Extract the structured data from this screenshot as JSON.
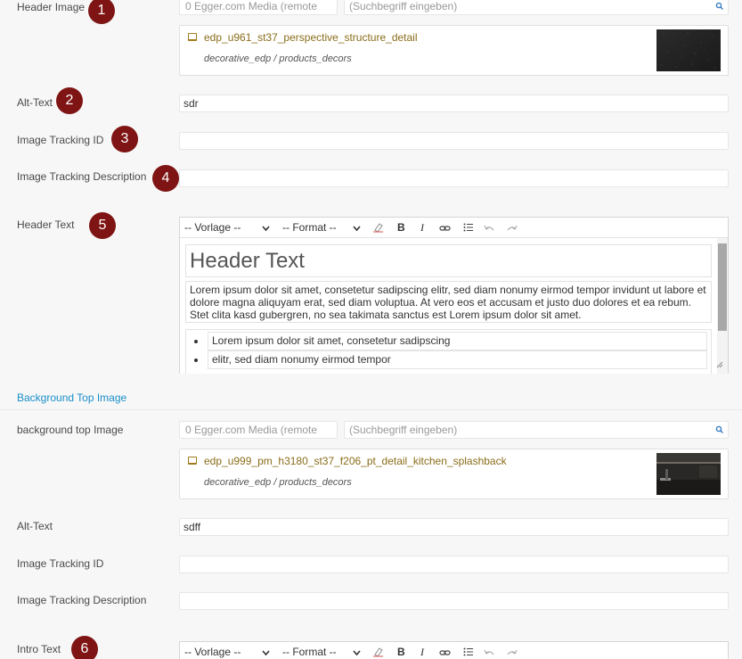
{
  "header_image": {
    "label": "Header Image",
    "badge": "1",
    "source_select": "0 Egger.com Media (remote",
    "search_placeholder": "(Suchbegriff eingeben)",
    "file_name": "edp_u961_st37_perspective_structure_detail",
    "file_path": "decorative_edp / products_decors"
  },
  "alt_text_1": {
    "label": "Alt-Text",
    "badge": "2",
    "value": "sdr"
  },
  "tracking_id_1": {
    "label": "Image Tracking ID",
    "badge": "3",
    "value": ""
  },
  "tracking_desc_1": {
    "label": "Image Tracking Description",
    "badge": "4",
    "value": ""
  },
  "header_text": {
    "label": "Header Text",
    "badge": "5",
    "toolbar": {
      "template_select": "-- Vorlage --",
      "format_select": "-- Format --",
      "buttons": [
        "eraser-icon",
        "bold-icon",
        "italic-icon",
        "link-icon",
        "list-icon",
        "undo-icon",
        "redo-icon"
      ]
    },
    "heading": "Header Text",
    "paragraph": "Lorem ipsum dolor sit amet, consetetur sadipscing elitr, sed diam nonumy eirmod tempor invidunt ut labore et dolore magna aliquyam erat, sed diam voluptua. At vero eos et accusam et justo duo dolores et ea rebum. Stet clita kasd gubergren, no sea takimata sanctus est Lorem ipsum dolor sit amet.",
    "list_items": [
      "Lorem ipsum dolor sit amet, consetetur sadipscing",
      "elitr, sed diam nonumy eirmod tempor"
    ]
  },
  "section": {
    "title": "Background Top Image"
  },
  "bg_top_image": {
    "label": "background top Image",
    "source_select": "0 Egger.com Media (remote",
    "search_placeholder": "(Suchbegriff eingeben)",
    "file_name": "edp_u999_pm_h3180_st37_f206_pt_detail_kitchen_splashback",
    "file_path": "decorative_edp / products_decors"
  },
  "alt_text_2": {
    "label": "Alt-Text",
    "value": "sdff"
  },
  "tracking_id_2": {
    "label": "Image Tracking ID",
    "value": ""
  },
  "tracking_desc_2": {
    "label": "Image Tracking Description",
    "value": ""
  },
  "intro_text": {
    "label": "Intro Text",
    "badge": "6",
    "toolbar": {
      "template_select": "-- Vorlage --",
      "format_select": "-- Format --"
    }
  },
  "colors": {
    "badge": "#7f1414",
    "link": "#1a8fc9",
    "file_name": "#8a6d1a",
    "background": "#f7f7f7"
  }
}
